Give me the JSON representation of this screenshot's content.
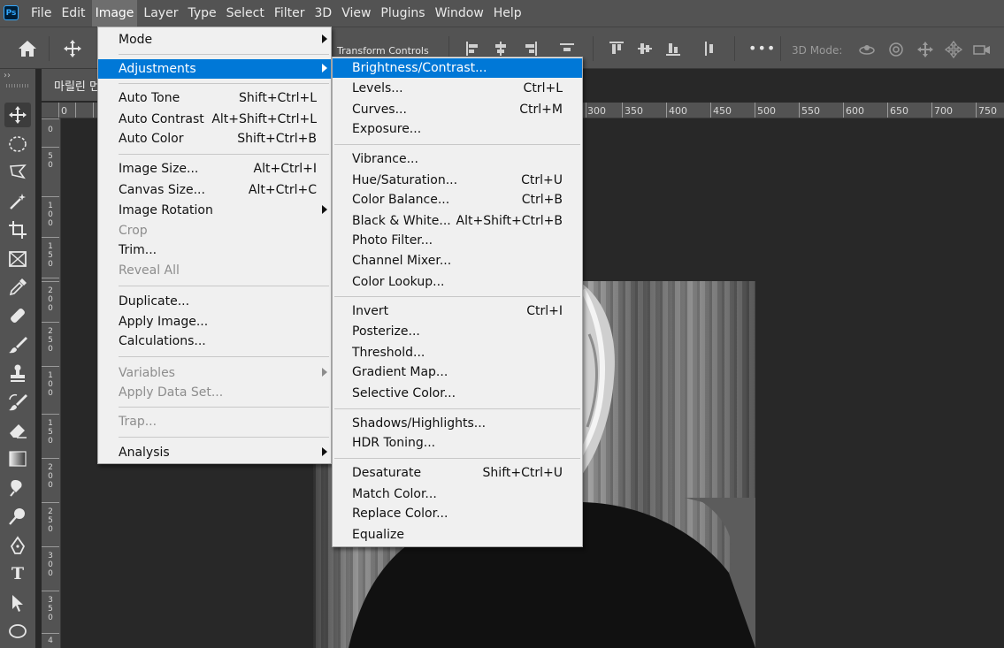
{
  "app": {
    "logo": "Ps"
  },
  "menubar": [
    {
      "label": "File"
    },
    {
      "label": "Edit"
    },
    {
      "label": "Image",
      "active": true
    },
    {
      "label": "Layer"
    },
    {
      "label": "Type"
    },
    {
      "label": "Select"
    },
    {
      "label": "Filter"
    },
    {
      "label": "3D"
    },
    {
      "label": "View"
    },
    {
      "label": "Plugins"
    },
    {
      "label": "Window"
    },
    {
      "label": "Help"
    }
  ],
  "options_bar": {
    "transform_controls_label": "Transform Controls",
    "more_label": "•••",
    "mode_3d_label": "3D Mode:"
  },
  "tools_panel": {
    "collapse_glyph": "››",
    "type_tool_glyph": "T"
  },
  "document_tab": {
    "title": "마릴린 먼"
  },
  "rulers": {
    "top_labels": [
      "0",
      "300",
      "350",
      "400",
      "450",
      "500",
      "550",
      "600",
      "650",
      "700",
      "750"
    ],
    "left_labels": [
      "0",
      "50",
      "100",
      "150",
      "200",
      "250",
      "0",
      "50",
      "100",
      "150",
      "200",
      "250",
      "300",
      "350",
      "4"
    ]
  },
  "image_menu": {
    "items": [
      {
        "label": "Mode",
        "submenu": true
      },
      {
        "label": "Adjustments",
        "submenu": true,
        "selected": true
      },
      {
        "label": "Auto Tone",
        "shortcut": "Shift+Ctrl+L"
      },
      {
        "label": "Auto Contrast",
        "shortcut": "Alt+Shift+Ctrl+L"
      },
      {
        "label": "Auto Color",
        "shortcut": "Shift+Ctrl+B"
      },
      {
        "label": "Image Size...",
        "shortcut": "Alt+Ctrl+I"
      },
      {
        "label": "Canvas Size...",
        "shortcut": "Alt+Ctrl+C"
      },
      {
        "label": "Image Rotation",
        "submenu": true
      },
      {
        "label": "Crop",
        "disabled": true
      },
      {
        "label": "Trim..."
      },
      {
        "label": "Reveal All",
        "disabled": true
      },
      {
        "label": "Duplicate..."
      },
      {
        "label": "Apply Image..."
      },
      {
        "label": "Calculations..."
      },
      {
        "label": "Variables",
        "submenu": true,
        "disabled": true
      },
      {
        "label": "Apply Data Set...",
        "disabled": true
      },
      {
        "label": "Trap...",
        "disabled": true
      },
      {
        "label": "Analysis",
        "submenu": true
      }
    ]
  },
  "adjustments_menu": {
    "items": [
      {
        "label": "Brightness/Contrast...",
        "selected": true
      },
      {
        "label": "Levels...",
        "shortcut": "Ctrl+L"
      },
      {
        "label": "Curves...",
        "shortcut": "Ctrl+M"
      },
      {
        "label": "Exposure..."
      },
      {
        "label": "Vibrance..."
      },
      {
        "label": "Hue/Saturation...",
        "shortcut": "Ctrl+U"
      },
      {
        "label": "Color Balance...",
        "shortcut": "Ctrl+B"
      },
      {
        "label": "Black & White...",
        "shortcut": "Alt+Shift+Ctrl+B"
      },
      {
        "label": "Photo Filter..."
      },
      {
        "label": "Channel Mixer..."
      },
      {
        "label": "Color Lookup..."
      },
      {
        "label": "Invert",
        "shortcut": "Ctrl+I"
      },
      {
        "label": "Posterize..."
      },
      {
        "label": "Threshold..."
      },
      {
        "label": "Gradient Map..."
      },
      {
        "label": "Selective Color..."
      },
      {
        "label": "Shadows/Highlights..."
      },
      {
        "label": "HDR Toning..."
      },
      {
        "label": "Desaturate",
        "shortcut": "Shift+Ctrl+U"
      },
      {
        "label": "Match Color..."
      },
      {
        "label": "Replace Color..."
      },
      {
        "label": "Equalize"
      }
    ]
  },
  "colors": {
    "menu_highlight": "#0078d7",
    "menu_background": "#f0f0f0",
    "chrome": "#535353",
    "workspace": "#282828"
  }
}
